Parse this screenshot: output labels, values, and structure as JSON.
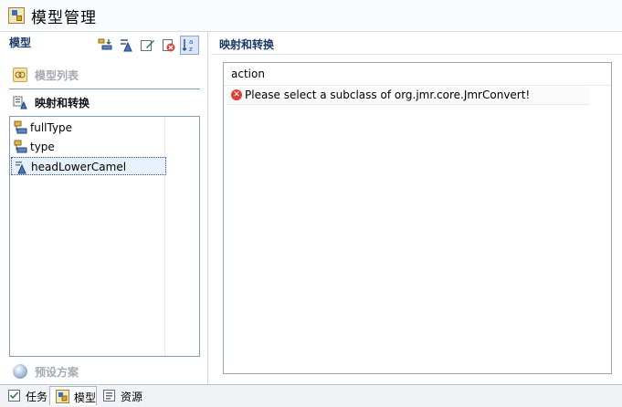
{
  "window": {
    "title": "模型管理"
  },
  "left_panel": {
    "header": "模型",
    "toolbar_icons": [
      "sort-icon",
      "attribute-icon",
      "edit-icon",
      "delete-icon",
      "sort-az-icon"
    ],
    "sections": {
      "model_list": "模型列表",
      "mapping": "映射和转换",
      "preset": "预设方案"
    },
    "tree_items": [
      {
        "label": "fullType",
        "icon": "field-icon"
      },
      {
        "label": "type",
        "icon": "field-icon"
      },
      {
        "label": "headLowerCamel",
        "icon": "attribute-icon",
        "selected": true
      }
    ]
  },
  "right_panel": {
    "header": "映射和转换",
    "box_title": "action",
    "error_message": "Please select a subclass of org.jmr.core.JmrConvert!"
  },
  "bottom_tabs": [
    {
      "label": "任务",
      "icon": "tasks-icon"
    },
    {
      "label": "模型",
      "icon": "model-icon",
      "active": true
    },
    {
      "label": "资源",
      "icon": "resources-icon"
    }
  ]
}
